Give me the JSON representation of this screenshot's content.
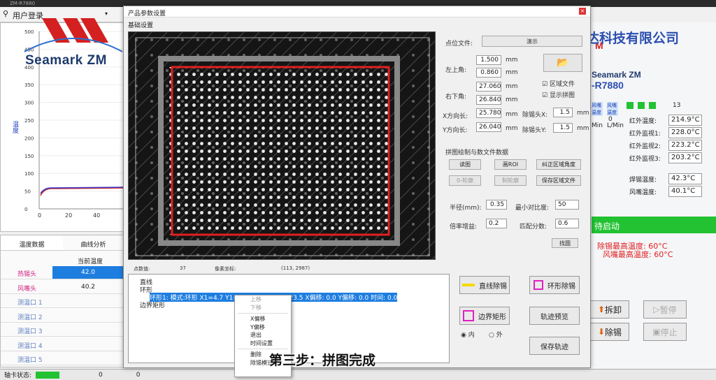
{
  "bg": {
    "window_title": "ZM-R7880",
    "login": "用户登录",
    "brand": "Seamark ZM",
    "brand_right": "Seamark ZM",
    "model": "-R7880",
    "company": "达科技有限公司",
    "y_axis_label": "温度",
    "y_ticks": [
      "500",
      "450",
      "400",
      "350",
      "300",
      "250",
      "200",
      "150",
      "100",
      "50",
      "0"
    ],
    "x_ticks": [
      "0",
      "20",
      "40"
    ],
    "tabs": [
      "温度数据",
      "曲线分析"
    ],
    "col_header": "当前温度",
    "rows": [
      {
        "label": "热锡头",
        "value": "42.0"
      },
      {
        "label": "风嘴头",
        "value": "40.2"
      },
      {
        "label": "测温口 1",
        "value": ""
      },
      {
        "label": "测温口 2",
        "value": ""
      },
      {
        "label": "测温口 3",
        "value": ""
      },
      {
        "label": "测温口 4",
        "value": ""
      },
      {
        "label": "测温口 5",
        "value": ""
      }
    ],
    "right_headers": [
      "风嘴温度",
      "风嘴温度"
    ],
    "right_small": [
      "Min",
      "L/Min",
      "0"
    ],
    "counter": "13",
    "counter2": "0",
    "temps": [
      {
        "label": "红外温度:",
        "value": "214.9°C"
      },
      {
        "label": "红外监视1:",
        "value": "228.0°C"
      },
      {
        "label": "红外监视2:",
        "value": "223.2°C"
      },
      {
        "label": "红外监视3:",
        "value": "203.2°C"
      },
      {
        "label": "焊锡温度:",
        "value": "42.3°C"
      },
      {
        "label": "风嘴温度:",
        "value": "40.1°C"
      }
    ],
    "status_green": "待启动",
    "max_temp1": "除锡最高温度: 60°C",
    "max_temp2": "风嘴最高温度: 60°C",
    "btn_disassemble": "拆卸",
    "btn_remove_tin": "除锡",
    "btn_pause": "暂停",
    "btn_stop": "停止",
    "status_label": "轴卡状态:",
    "status_values": [
      "0",
      "0",
      "0"
    ]
  },
  "dialog": {
    "title": "产品参数设置",
    "close": "×",
    "tab": "基础设置",
    "point_file_label": "点位文件:",
    "point_file_value": "演示",
    "top_left_label": "左上角:",
    "top_left": [
      "1.500",
      "0.860"
    ],
    "bottom_right_label": "右下角:",
    "bottom_right": [
      "27.060",
      "26.840"
    ],
    "unit": "mm",
    "x_len_label": "X方向长:",
    "x_len": "25.780",
    "y_len_label": "Y方向长:",
    "y_len": "26.040",
    "chk_region": "区域文件",
    "chk_show": "显示拼图",
    "head_x_label": "除锡头X:",
    "head_x": "1.5",
    "head_y_label": "除锡头Y:",
    "head_y": "1.5",
    "section": "拼图绘制与数文件数据",
    "btn_read": "读图",
    "btn_roi": "画ROI",
    "btn_fix": "纠正区域角度",
    "btn_a": "0-轮廓",
    "btn_b": "制轮廓",
    "btn_save_region": "保存区域文件",
    "radius_label": "半径(mm):",
    "radius": "0.35",
    "min_ratio_label": "最小对比度:",
    "min_ratio": "50",
    "rate_label": "倍率增益:",
    "rate": "0.2",
    "match_label": "匹配分数:",
    "match": "0.6",
    "btn_find": "找圆",
    "info_count_label": "点数值:",
    "info_count": "37",
    "info_coord_label": "像素坐标:",
    "info_coord": "(113, 2987)",
    "tree_root1": "直线",
    "tree_root2": "环形",
    "tree_sel": "环形1: 模式:环形 X1=4.7 Y1=... X2=22.0 Y2=23.5 X偏移: 0.0 Y偏移: 0.0 时间: 0.0",
    "tree_root3": "边界矩形",
    "ctx_items": [
      "上移",
      "下移",
      "X偏移",
      "Y偏移",
      "退出",
      "时间设置",
      "删除",
      "除锡模式"
    ],
    "btn_line": "直线除锡",
    "btn_ring": "环形除锡",
    "btn_rect": "边界矩形",
    "radio_in": "内",
    "radio_out": "外",
    "btn_preview": "轨迹预览",
    "btn_save_track": "保存轨迹"
  },
  "subtitle": "第三步：拼图完成",
  "colors": {
    "accent_red": "#e02020",
    "green": "#22c232",
    "yellow": "#f5d800",
    "magenta": "#e020c0"
  }
}
